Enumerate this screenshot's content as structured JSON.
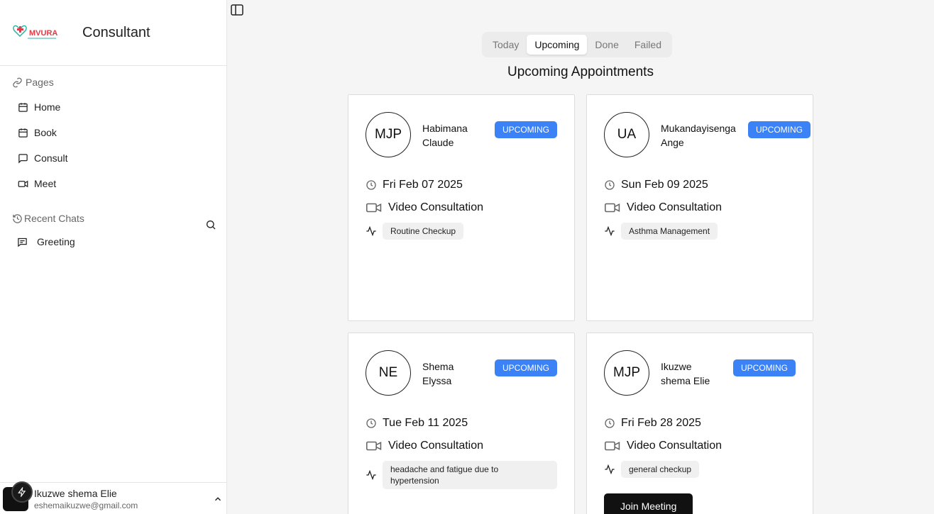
{
  "sidebar": {
    "app_title": "Consultant",
    "logo_text": "MVURA",
    "pages_label": "Pages",
    "nav": [
      {
        "label": "Home",
        "icon": "calendar-icon"
      },
      {
        "label": "Book",
        "icon": "calendar-icon"
      },
      {
        "label": "Consult",
        "icon": "message-icon"
      },
      {
        "label": "Meet",
        "icon": "video-icon"
      }
    ],
    "recent_label": "Recent Chats",
    "chats": [
      {
        "label": "Greeting"
      }
    ],
    "user": {
      "name": "Ikuzwe shema Elie",
      "email": "eshemaikuzwe@gmail.com"
    }
  },
  "tabs": [
    "Today",
    "Upcoming",
    "Done",
    "Failed"
  ],
  "active_tab": "Upcoming",
  "heading": "Upcoming Appointments",
  "appointments": [
    {
      "initials": "MJP",
      "name_line1": "Habimana",
      "name_line2": "Claude",
      "status": "UPCOMING",
      "date": "Fri Feb 07 2025",
      "type": "Video Consultation",
      "reason": "Routine Checkup"
    },
    {
      "initials": "UA",
      "name_line1": "Mukandayisenga",
      "name_line2": "Ange",
      "status": "UPCOMING",
      "date": "Sun Feb 09 2025",
      "type": "Video Consultation",
      "reason": "Asthma Management"
    },
    {
      "initials": "NE",
      "name_line1": "Shema",
      "name_line2": "Elyssa",
      "status": "UPCOMING",
      "date": "Tue Feb 11 2025",
      "type": "Video Consultation",
      "reason": "headache and fatigue due to hypertension"
    },
    {
      "initials": "MJP",
      "name_line1": "Ikuzwe",
      "name_line2": "shema Elie",
      "status": "UPCOMING",
      "date": "Fri Feb 28 2025",
      "type": "Video Consultation",
      "reason": "general checkup",
      "action": "Join Meeting"
    }
  ],
  "colors": {
    "badge": "#3b82f6",
    "accent_dark": "#111111",
    "logo_red": "#e53945",
    "logo_teal": "#2bb3a6"
  }
}
